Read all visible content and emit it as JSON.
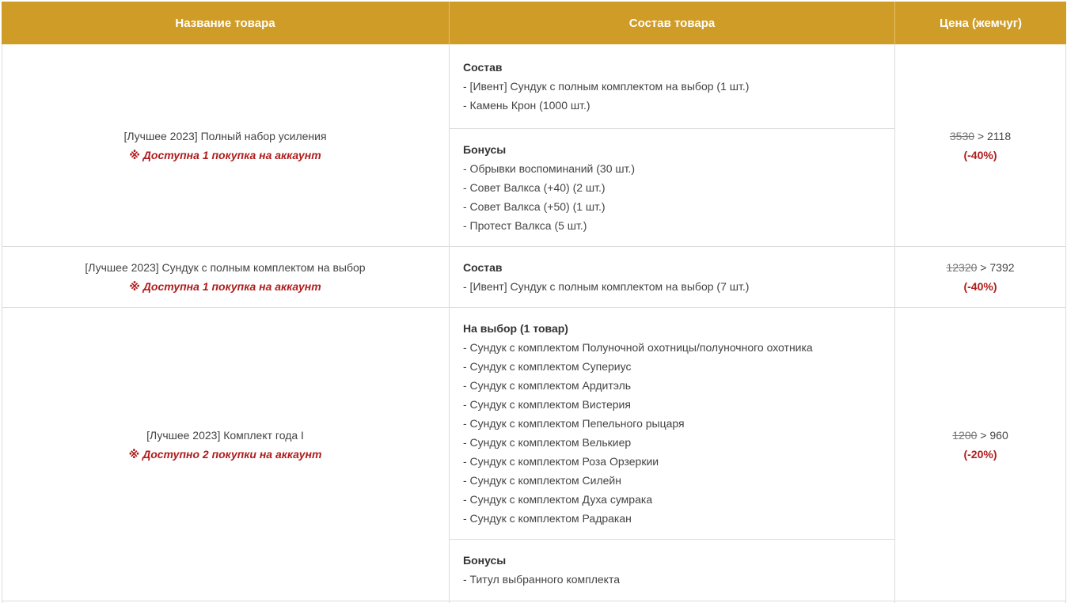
{
  "header": {
    "col_name": "Название товара",
    "col_contents": "Состав товара",
    "col_price": "Цена (жемчуг)"
  },
  "rows": [
    {
      "name": "[Лучшее 2023] Полный набор усиления",
      "mark": "※",
      "note": "Доступна 1 покупка на аккаунт",
      "sections": [
        {
          "title": "Состав",
          "items": [
            "- [Ивент] Сундук с полным комплектом на выбор (1 шт.)",
            "- Камень Крон (1000 шт.)"
          ]
        },
        {
          "title": "Бонусы",
          "items": [
            "- Обрывки воспоминаний (30 шт.)",
            "- Совет Валкса (+40) (2 шт.)",
            "- Совет Валкса (+50) (1 шт.)",
            "- Протест Валкса (5 шт.)"
          ]
        }
      ],
      "price_old": "3530",
      "price_arrow": " > ",
      "price_new": "2118",
      "discount": "(-40%)"
    },
    {
      "name": "[Лучшее 2023] Сундук с полным комплектом на выбор",
      "mark": "※",
      "note": "Доступна 1 покупка на аккаунт",
      "sections": [
        {
          "title": "Состав",
          "items": [
            "- [Ивент] Сундук с полным комплектом на выбор (7 шт.)"
          ]
        }
      ],
      "price_old": "12320",
      "price_arrow": " > ",
      "price_new": "7392",
      "discount": "(-40%)"
    },
    {
      "name": "[Лучшее 2023] Комплект года I",
      "mark": "※",
      "note": "Доступно 2 покупки на аккаунт",
      "sections": [
        {
          "title": "На выбор (1 товар)",
          "items": [
            "- Сундук с комплектом Полуночной охотницы/полуночного охотника",
            "- Сундук с комплектом Супериус",
            "- Сундук с комплектом Ардитэль",
            "- Сундук с комплектом Вистерия",
            "- Сундук с комплектом Пепельного рыцаря",
            "- Сундук с комплектом Велькиер",
            "- Сундук с комплектом Роза Орзеркии",
            "- Сундук с комплектом Силейн",
            "- Сундук с комплектом Духа сумрака",
            "- Сундук с комплектом Радракан"
          ]
        },
        {
          "title": "Бонусы",
          "items": [
            "- Титул выбранного комплекта"
          ]
        }
      ],
      "price_old": "1200",
      "price_arrow": " > ",
      "price_new": "960",
      "discount": "(-20%)"
    }
  ]
}
